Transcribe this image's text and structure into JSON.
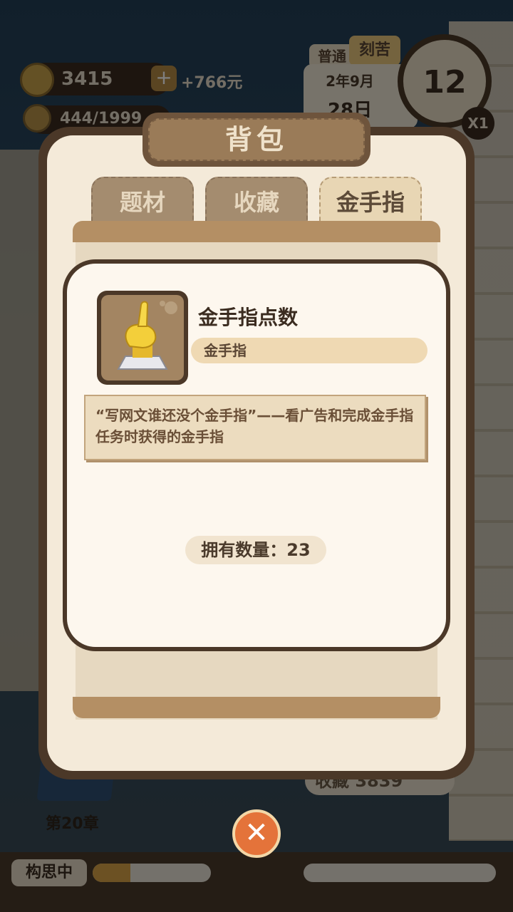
{
  "hud": {
    "coins": "3415",
    "income": "+766元",
    "energy": "444/1999",
    "mode_normal": "普通",
    "mode_hard": "刻苦",
    "date_year_month": "2年9月",
    "date_day": "28日",
    "hour": "12",
    "speed": "X1"
  },
  "panel": {
    "title": "背包",
    "tabs": [
      {
        "label": "题材"
      },
      {
        "label": "收藏"
      },
      {
        "label": "金手指"
      }
    ]
  },
  "item": {
    "name": "金手指点数",
    "category": "金手指",
    "description": "“写网文谁还没个金手指”——看广告和完成金手指任务时获得的金手指",
    "count_label": "拥有数量：23"
  },
  "bottom": {
    "chapter": "第20章",
    "collect": "收藏 3839",
    "status": "构思中",
    "progress_fraction": 0.32
  },
  "colors": {
    "panel_border": "#4b3828",
    "panel_bg": "#f4ead9",
    "accent_close": "#e4733a"
  },
  "icons": {
    "item": "golden-finger-icon",
    "coin": "coin-icon",
    "energy": "lightbulb-icon",
    "close": "close-icon"
  }
}
